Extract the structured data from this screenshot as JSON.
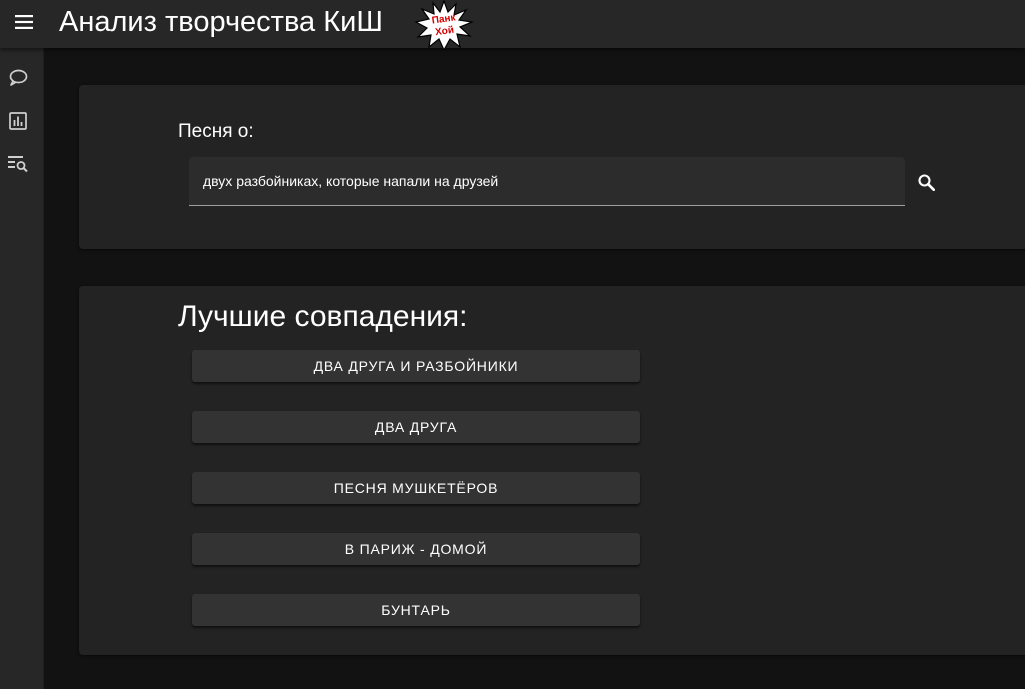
{
  "header": {
    "title": "Анализ творчества КиШ",
    "logo_text": "Панк Хой",
    "menu_icon": "menu-icon"
  },
  "sidebar": {
    "items": [
      {
        "icon": "chat-bubble-icon"
      },
      {
        "icon": "bar-chart-icon"
      },
      {
        "icon": "manage-search-icon"
      }
    ]
  },
  "search": {
    "label": "Песня о:",
    "value": "двух разбойниках, которые напали на друзей",
    "button_icon": "search-icon"
  },
  "results": {
    "title": "Лучшие совпадения:",
    "items": [
      "Два друга и разбойники",
      "Два друга",
      "Песня мушкетёров",
      "В Париж - домой",
      "Бунтарь"
    ]
  },
  "colors": {
    "background": "#121212",
    "appbar": "#272727",
    "card": "#232323",
    "button": "#333333",
    "logo_accent": "#d40000"
  }
}
